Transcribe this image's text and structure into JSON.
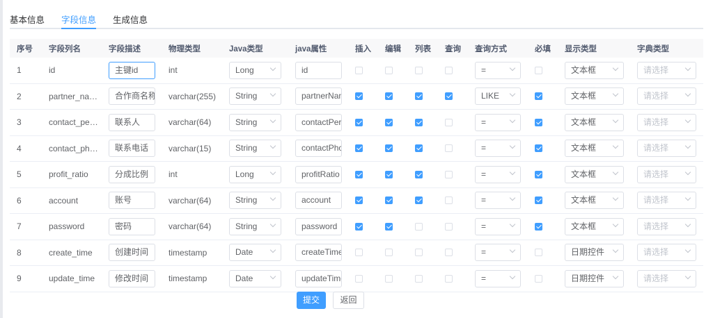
{
  "tabs": [
    "基本信息",
    "字段信息",
    "生成信息"
  ],
  "active_tab": 1,
  "columns": [
    "序号",
    "字段列名",
    "字段描述",
    "物理类型",
    "Java类型",
    "java属性",
    "插入",
    "编辑",
    "列表",
    "查询",
    "查询方式",
    "必填",
    "显示类型",
    "字典类型"
  ],
  "dict_placeholder": "请选择",
  "rows": [
    {
      "no": "1",
      "column": "id",
      "desc": "主键id",
      "phys": "int",
      "java_type": "Long",
      "java_field": "id",
      "insert": false,
      "edit": false,
      "list": false,
      "query": false,
      "query_type": "=",
      "required": false,
      "html_type": "文本框"
    },
    {
      "no": "2",
      "column": "partner_na…",
      "desc": "合作商名称",
      "phys": "varchar(255)",
      "java_type": "String",
      "java_field": "partnerName",
      "insert": true,
      "edit": true,
      "list": true,
      "query": true,
      "query_type": "LIKE",
      "required": true,
      "html_type": "文本框"
    },
    {
      "no": "3",
      "column": "contact_pe…",
      "desc": "联系人",
      "phys": "varchar(64)",
      "java_type": "String",
      "java_field": "contactPerson",
      "insert": true,
      "edit": true,
      "list": true,
      "query": false,
      "query_type": "=",
      "required": true,
      "html_type": "文本框"
    },
    {
      "no": "4",
      "column": "contact_ph…",
      "desc": "联系电话",
      "phys": "varchar(15)",
      "java_type": "String",
      "java_field": "contactPhone",
      "insert": true,
      "edit": true,
      "list": true,
      "query": false,
      "query_type": "=",
      "required": true,
      "html_type": "文本框"
    },
    {
      "no": "5",
      "column": "profit_ratio",
      "desc": "分成比例",
      "phys": "int",
      "java_type": "Long",
      "java_field": "profitRatio",
      "insert": true,
      "edit": true,
      "list": true,
      "query": false,
      "query_type": "=",
      "required": true,
      "html_type": "文本框"
    },
    {
      "no": "6",
      "column": "account",
      "desc": "账号",
      "phys": "varchar(64)",
      "java_type": "String",
      "java_field": "account",
      "insert": true,
      "edit": true,
      "list": true,
      "query": false,
      "query_type": "=",
      "required": true,
      "html_type": "文本框"
    },
    {
      "no": "7",
      "column": "password",
      "desc": "密码",
      "phys": "varchar(64)",
      "java_type": "String",
      "java_field": "password",
      "insert": true,
      "edit": true,
      "list": false,
      "query": false,
      "query_type": "=",
      "required": true,
      "html_type": "文本框"
    },
    {
      "no": "8",
      "column": "create_time",
      "desc": "创建时间",
      "phys": "timestamp",
      "java_type": "Date",
      "java_field": "createTime",
      "insert": false,
      "edit": false,
      "list": false,
      "query": false,
      "query_type": "=",
      "required": false,
      "html_type": "日期控件"
    },
    {
      "no": "9",
      "column": "update_time",
      "desc": "修改时间",
      "phys": "timestamp",
      "java_type": "Date",
      "java_field": "updateTime",
      "insert": false,
      "edit": false,
      "list": false,
      "query": false,
      "query_type": "=",
      "required": false,
      "html_type": "日期控件"
    }
  ],
  "buttons": {
    "submit": "提交",
    "back": "返回"
  },
  "colors": {
    "accent": "#409eff"
  }
}
